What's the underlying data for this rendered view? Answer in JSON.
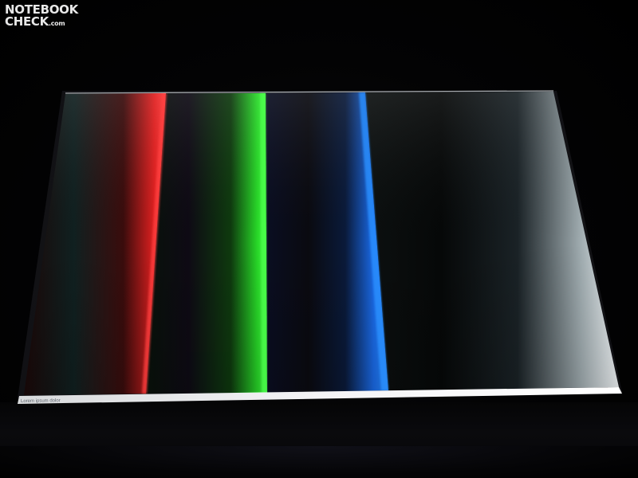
{
  "watermark": {
    "line1": "NOTEBOOK",
    "line2_main": "CHECK",
    "line2_domain": ".com"
  },
  "screen": {
    "taskbar_text": "Lorem ipsum dolor",
    "bars": [
      {
        "name": "red",
        "color": "#ff2a2a"
      },
      {
        "name": "green",
        "color": "#2cff2c"
      },
      {
        "name": "blue",
        "color": "#1a7dff"
      },
      {
        "name": "white",
        "color": "#f2f6fa"
      }
    ]
  }
}
